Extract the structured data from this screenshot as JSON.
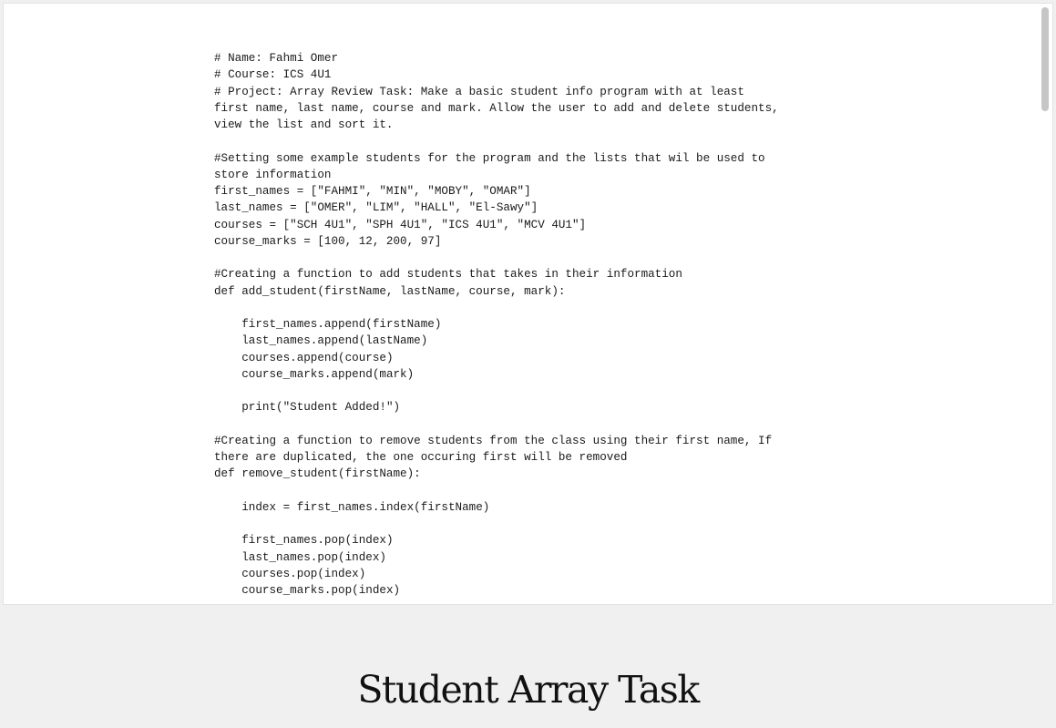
{
  "code": {
    "lines": [
      "# Name: Fahmi Omer",
      "# Course: ICS 4U1",
      "# Project: Array Review Task: Make a basic student info program with at least",
      "first name, last name, course and mark. Allow the user to add and delete students,",
      "view the list and sort it.",
      "",
      "#Setting some example students for the program and the lists that wil be used to",
      "store information",
      "first_names = [\"FAHMI\", \"MIN\", \"MOBY\", \"OMAR\"]",
      "last_names = [\"OMER\", \"LIM\", \"HALL\", \"El-Sawy\"]",
      "courses = [\"SCH 4U1\", \"SPH 4U1\", \"ICS 4U1\", \"MCV 4U1\"]",
      "course_marks = [100, 12, 200, 97]",
      "",
      "#Creating a function to add students that takes in their information",
      "def add_student(firstName, lastName, course, mark):",
      "",
      "    first_names.append(firstName)",
      "    last_names.append(lastName)",
      "    courses.append(course)",
      "    course_marks.append(mark)",
      "",
      "    print(\"Student Added!\")",
      "",
      "#Creating a function to remove students from the class using their first name, If",
      "there are duplicated, the one occuring first will be removed",
      "def remove_student(firstName):",
      "",
      "    index = first_names.index(firstName)",
      "",
      "    first_names.pop(index)",
      "    last_names.pop(index)",
      "    courses.pop(index)",
      "    course_marks.pop(index)"
    ]
  },
  "heading": {
    "title": "Student Array Task"
  },
  "colors": {
    "page_background": "#f0f0f0",
    "frame_background": "#ffffff",
    "scrollbar_thumb": "#c6c6c6"
  }
}
